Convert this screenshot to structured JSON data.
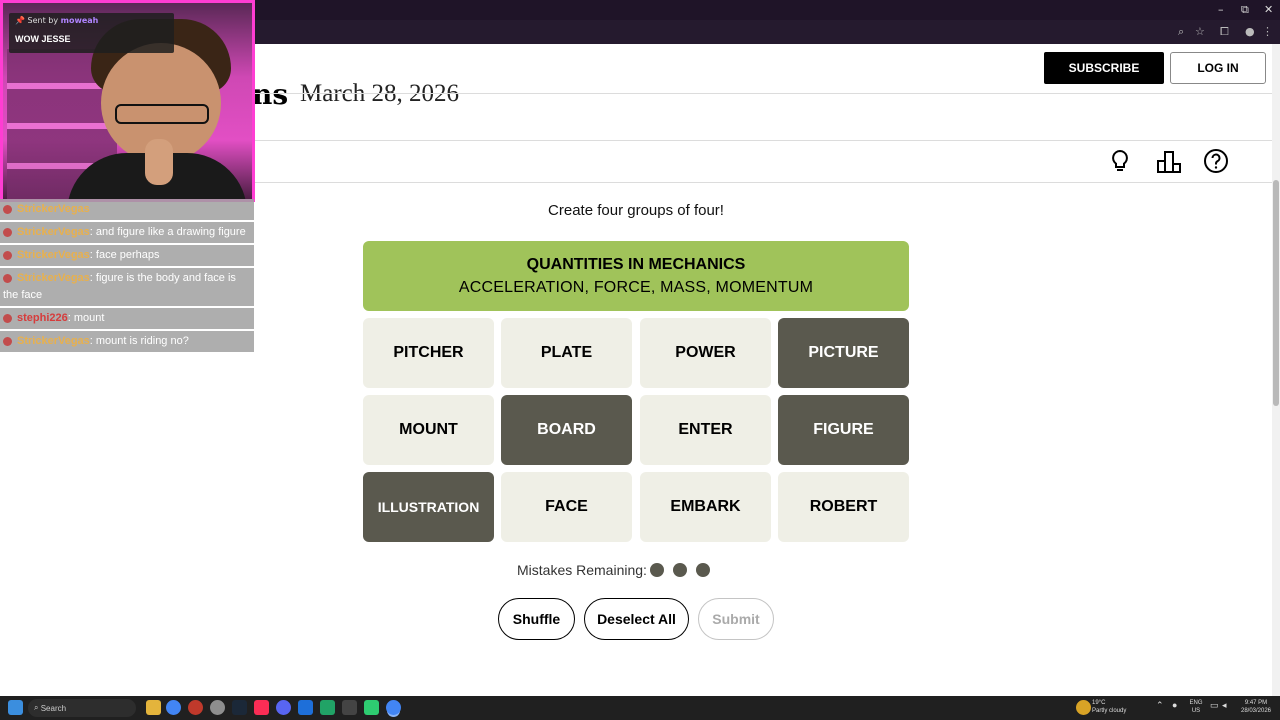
{
  "header": {
    "title_partial": "ns",
    "date": "March 28, 2026",
    "subscribe_label": "SUBSCRIBE",
    "login_label": "LOG IN"
  },
  "toolbar": {
    "icons": [
      "lightbulb-icon",
      "leaderboard-icon",
      "help-icon"
    ]
  },
  "game": {
    "instructions": "Create four groups of four!",
    "solved": [
      {
        "title": "QUANTITIES IN MECHANICS",
        "words": "ACCELERATION, FORCE, MASS, MOMENTUM",
        "color": "#a0c35a"
      }
    ],
    "tiles": [
      {
        "label": "PITCHER",
        "selected": false
      },
      {
        "label": "PLATE",
        "selected": false
      },
      {
        "label": "POWER",
        "selected": false
      },
      {
        "label": "PICTURE",
        "selected": true
      },
      {
        "label": "MOUNT",
        "selected": false
      },
      {
        "label": "BOARD",
        "selected": true
      },
      {
        "label": "ENTER",
        "selected": false
      },
      {
        "label": "FIGURE",
        "selected": true
      },
      {
        "label": "ILLUSTRATION",
        "selected": true
      },
      {
        "label": "FACE",
        "selected": false
      },
      {
        "label": "EMBARK",
        "selected": false
      },
      {
        "label": "ROBERT",
        "selected": false
      }
    ],
    "mistakes_label": "Mistakes Remaining:",
    "mistakes_remaining": 3,
    "buttons": {
      "shuffle": "Shuffle",
      "deselect": "Deselect All",
      "submit": "Submit"
    },
    "colors": {
      "selected": "#5a594e",
      "unselected": "#efefe6"
    }
  },
  "stream_overlay": {
    "alert": {
      "sent_by": "Sent by",
      "user": "moweah",
      "message": "WOW JESSE"
    },
    "chat": [
      {
        "user": "StrickerVegas",
        "text": ""
      },
      {
        "user": "StrickerVegas",
        "text": ": and figure like a drawing figure"
      },
      {
        "user": "StrickerVegas",
        "text": ": face perhaps"
      },
      {
        "user": "StrickerVegas",
        "text": ": figure is the body and face is the face"
      },
      {
        "user": "stephi226",
        "text": ": mount"
      },
      {
        "user": "StrickerVegas",
        "text": ": mount is riding no?"
      }
    ]
  },
  "taskbar": {
    "search_label": "Search",
    "weather": {
      "temp": "19°C",
      "condition": "Partly cloudy"
    },
    "lang": [
      "ENG",
      "US"
    ],
    "time": "9:47 PM",
    "date": "28/03/2026"
  }
}
